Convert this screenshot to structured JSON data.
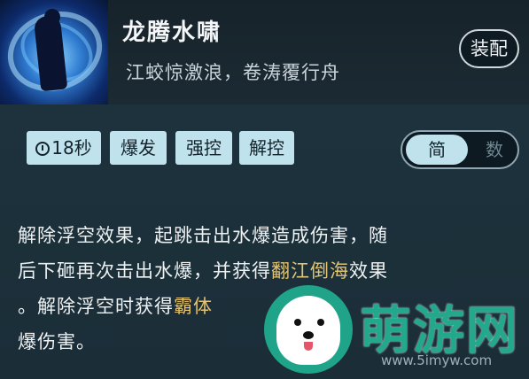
{
  "skill": {
    "name": "龙腾水啸",
    "description": "江蛟惊激浪，卷涛覆行舟",
    "icon": "dragon-water-swirl-icon"
  },
  "equip_label": "装配",
  "tags": {
    "cooldown": "18秒",
    "items": [
      "爆发",
      "强控",
      "解控"
    ]
  },
  "mode_toggle": {
    "simple": "简",
    "number": "数",
    "selected": "简"
  },
  "body": {
    "line1": "解除浮空效果，起跳击出水爆造成伤害，随",
    "line2_pre": "后下砸再次击出水爆，并获得",
    "line2_hl": "翻江倒海",
    "line2_post": "效果",
    "line3_pre": "。解除浮空时获得",
    "line3_hl": "霸体",
    "line4": "爆伤害。"
  },
  "watermark": {
    "text": "萌游网",
    "url": "www.5imyw.com",
    "icon": "dog-mascot-icon"
  },
  "colors": {
    "accent_tag": "#bfe2ec",
    "highlight": "#e3c472",
    "watermark": "#21a88d"
  }
}
